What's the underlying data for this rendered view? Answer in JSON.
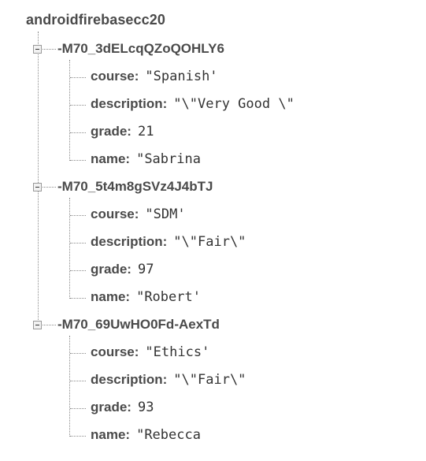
{
  "root": {
    "title": "androidfirebasecc20"
  },
  "nodes": [
    {
      "key": "-M70_3dELcqQZoQOHLY6",
      "fields": [
        {
          "label": "course:",
          "value": "\"Spanish'"
        },
        {
          "label": "description:",
          "value": "\"\\\"Very Good \\\""
        },
        {
          "label": "grade:",
          "value": "21"
        },
        {
          "label": "name:",
          "value": "\"Sabrina"
        }
      ]
    },
    {
      "key": "-M70_5t4m8gSVz4J4bTJ",
      "fields": [
        {
          "label": "course:",
          "value": "\"SDM'"
        },
        {
          "label": "description:",
          "value": "\"\\\"Fair\\\""
        },
        {
          "label": "grade:",
          "value": "97"
        },
        {
          "label": "name:",
          "value": "\"Robert'"
        }
      ]
    },
    {
      "key": "-M70_69UwHO0Fd-AexTd",
      "fields": [
        {
          "label": "course:",
          "value": "\"Ethics'"
        },
        {
          "label": "description:",
          "value": "\"\\\"Fair\\\""
        },
        {
          "label": "grade:",
          "value": "93"
        },
        {
          "label": "name:",
          "value": "\"Rebecca"
        }
      ]
    }
  ],
  "icons": {
    "collapse": "collapse-minus-icon"
  }
}
